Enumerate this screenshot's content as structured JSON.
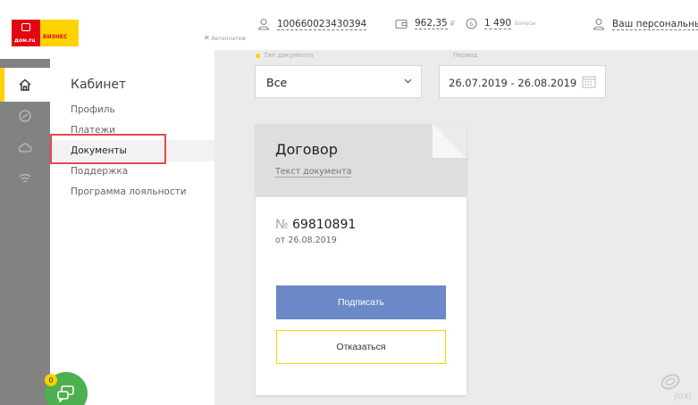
{
  "logo": {
    "brand": "дом.ru",
    "sub": "БИЗНЕС"
  },
  "header": {
    "account_number": "100660023430394",
    "balance": "962,35",
    "currency": "₽",
    "autopay": "Автоплатеж",
    "bonus_value": "1 490",
    "bonus_label": "Бонусы",
    "personal": "Ваш персональный"
  },
  "menu": {
    "title": "Кабинет",
    "items": [
      {
        "label": "Профиль"
      },
      {
        "label": "Платежи"
      },
      {
        "label": "Документы"
      },
      {
        "label": "Поддержка"
      },
      {
        "label": "Программа лояльности"
      }
    ]
  },
  "filters": {
    "doc_type_label": "Тип документа",
    "doc_type_value": "Все",
    "period_label": "Период",
    "period_value": "26.07.2019 - 26.08.2019"
  },
  "card": {
    "title": "Договор",
    "link": "Текст документа",
    "number_sign": "№",
    "number": "69810891",
    "date": "от 26.08.2019",
    "sign_button": "Подписать",
    "refuse_button": "Отказаться"
  },
  "chat": {
    "badge": "0"
  },
  "watermark": "joxi"
}
